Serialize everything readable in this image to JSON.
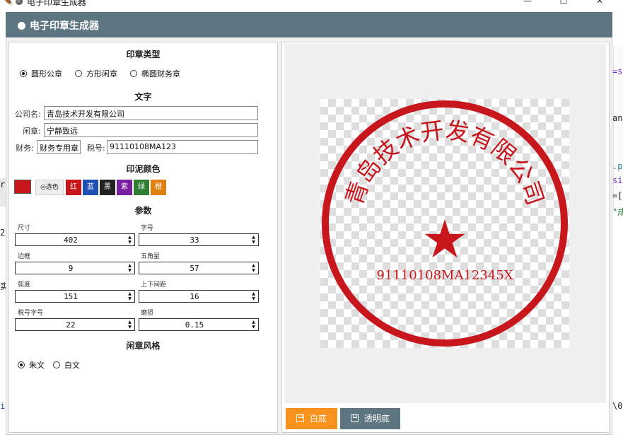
{
  "window": {
    "title": "电子印章生成器",
    "minimize": "—",
    "maximize": "☐",
    "close": "✕"
  },
  "header": {
    "title": "电子印章生成器"
  },
  "seal_type": {
    "title": "印章类型",
    "options": [
      "圆形公章",
      "方形闲章",
      "椭圆财务章"
    ],
    "selected": "圆形公章"
  },
  "text": {
    "title": "文字",
    "company_label": "公司名:",
    "company_value": "青岛技术开发有限公司",
    "leisure_label": "闲章:",
    "leisure_value": "宁静致远",
    "finance_label": "财务:",
    "finance_value": "财务专用章",
    "tax_label": "税号:",
    "tax_value": "91110108MA123"
  },
  "ink": {
    "title": "印泥颜色",
    "current_color": "#c8161d",
    "pick_label": "选色",
    "presets": [
      {
        "label": "红",
        "color": "#c8161d"
      },
      {
        "label": "蓝",
        "color": "#1f4fb4"
      },
      {
        "label": "黑",
        "color": "#222222"
      },
      {
        "label": "紫",
        "color": "#7b1fa2"
      },
      {
        "label": "绿",
        "color": "#2e7d32"
      },
      {
        "label": "橙",
        "color": "#e08010"
      }
    ]
  },
  "params": {
    "title": "参数",
    "fields": [
      {
        "label": "尺寸",
        "value": "402"
      },
      {
        "label": "字号",
        "value": "33"
      },
      {
        "label": "边框",
        "value": "9"
      },
      {
        "label": "五角星",
        "value": "57"
      },
      {
        "label": "弧度",
        "value": "151"
      },
      {
        "label": "上下间距",
        "value": "16"
      },
      {
        "label": "税号字号",
        "value": "22"
      },
      {
        "label": "磨损",
        "value": "0.15"
      }
    ]
  },
  "style": {
    "title": "闲章风格",
    "options": [
      "朱文",
      "白文"
    ],
    "selected": "朱文"
  },
  "preview": {
    "arc_text": "青岛技术开发有限公司",
    "tax_text": "91110108MA12345X",
    "seal_color": "#c8161d"
  },
  "buttons": {
    "white_bg": "白底",
    "transparent_bg": "透明底",
    "white_bg_color": "#f7931e",
    "transparent_bg_color": "#5c7580"
  },
  "background_snippets": [
    "=s",
    "an",
    ".p",
    "si",
    "=[",
    "\"成",
    "2",
    "r.",
    "实",
    "\\0",
    "i"
  ]
}
